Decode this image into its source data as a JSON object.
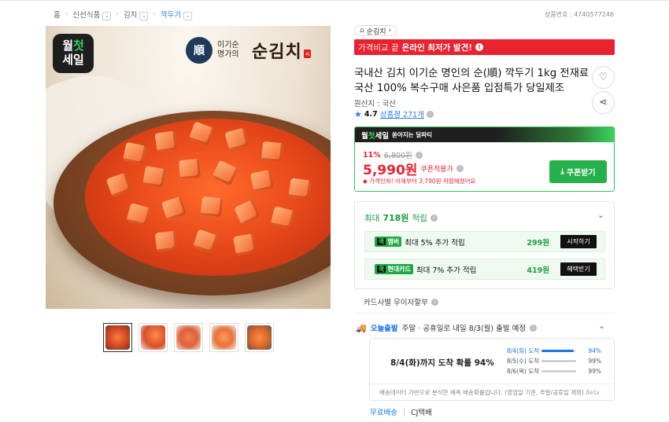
{
  "breadcrumb": {
    "home": "홈",
    "items": [
      {
        "label": "신선식품"
      },
      {
        "label": "김치"
      },
      {
        "label": "깍두기",
        "active": true
      }
    ]
  },
  "product_number": "상품번호 : 4740577246",
  "hero": {
    "badge_line1": "월",
    "badge_line1b": "첫",
    "badge_line2": "세일",
    "brand_seal": "順",
    "brand_small": "이기순 명가의",
    "brand_name": "순김치",
    "brand_tag": "씨"
  },
  "thumbnails": [
    {
      "name": "thumb-1",
      "color": "#c84520"
    },
    {
      "name": "thumb-2",
      "color": "#d94f2a"
    },
    {
      "name": "thumb-3",
      "color": "#e0603a"
    },
    {
      "name": "thumb-4",
      "color": "#e8713d"
    },
    {
      "name": "thumb-5",
      "color": "#d5652c"
    }
  ],
  "store": {
    "icon": "home-icon",
    "name": "순김치",
    "arrow": "›"
  },
  "promo": {
    "text_lite": "가격비교 끝",
    "text_bold": "온라인 최저가 발견!",
    "info": "!"
  },
  "title": "국내산 김치 이기순 명인의 순(順) 깍두기 1kg 전재료 국산 100% 복수구매 사은품 입점특가 당일제조",
  "origin": "원산지 : 국산",
  "rating": {
    "score": "4.7",
    "reviews": "상품평 271개"
  },
  "price_box": {
    "header_a": "월",
    "header_b": "첫",
    "header_c": "세일",
    "header_sub": "쏟아지는 딜파티",
    "discount": "11%",
    "original": "6,800원",
    "price": "5,990원",
    "coupon_label": "쿠폰적용가",
    "history": "가격인하! 어제부터 3,790원 저렴해졌어요",
    "coupon_button": "쿠폰받기"
  },
  "points": {
    "head_prefix": "최대",
    "head_amount": "718원",
    "head_suffix": "적립",
    "rows": [
      {
        "chip_a": "쿡",
        "chip_b": "멤버",
        "label": "최대 5% 추가 적립",
        "amount": "299원",
        "button": "시작하기"
      },
      {
        "chip_a": "쿡",
        "chip_b": "현대카드",
        "label": "최대 7% 추가 적립",
        "amount": "419원",
        "button": "혜택받기"
      }
    ]
  },
  "installment": "카드사별 무이자할부",
  "shipping": {
    "today": "오늘출발",
    "text": "주말 · 공휴일로 내일 8/3(월) 출발 예정",
    "main": "8/4(화)까지 도착 확률 94%",
    "rows": [
      {
        "date": "8/4(화) 도착",
        "value": 94,
        "label": "94%",
        "color": "#1a73e8"
      },
      {
        "date": "8/5(수) 도착",
        "value": 99,
        "label": "99%",
        "color": "#d0d0d0"
      },
      {
        "date": "8/6(목) 도착",
        "value": 99,
        "label": "99%",
        "color": "#d0d0d0"
      }
    ],
    "note": "배송데이터 기반으로 분석한 예측 배송확률입니다. (영업일 기준, 주말/공휴일 제외)",
    "beta": "Beta",
    "free": "무료배송",
    "carrier": "CJ택배"
  }
}
